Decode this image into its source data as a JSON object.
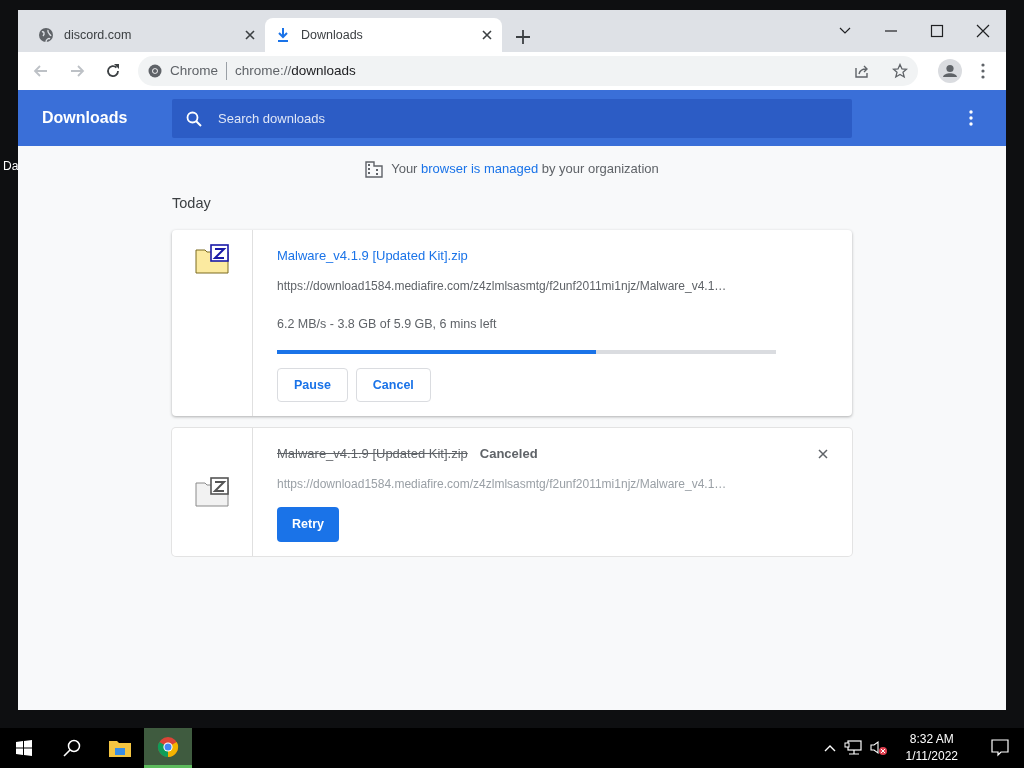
{
  "desktop": {
    "icon_label": "Da"
  },
  "tabs": [
    {
      "title": "discord.com",
      "kind": "site",
      "selected": false
    },
    {
      "title": "Downloads",
      "kind": "download",
      "selected": true
    }
  ],
  "omnibox": {
    "chip": "Chrome",
    "url_prefix": "chrome://",
    "url_path": "downloads"
  },
  "page": {
    "title": "Downloads",
    "search": {
      "placeholder": "Search downloads"
    },
    "managed_notice": {
      "before": "Your",
      "link": "browser is managed",
      "after": "by your organization"
    },
    "section": "Today",
    "downloads": [
      {
        "file_name": "Malware_v4.1.9 [Updated Kit].zip",
        "canceled": false,
        "url": "https://download1584.mediafire.com/z4zlmlsasmtg/f2unf2011mi1njz/Malware_v4.1…",
        "status_text": "6.2 MB/s - 3.8 GB of 5.9 GB, 6 mins left",
        "level": 0.64,
        "buttons": [
          {
            "label": "Pause",
            "kind": "outline"
          },
          {
            "label": "Cancel",
            "kind": "outline"
          }
        ]
      },
      {
        "file_name": "Malware_v4.1.9 [Updated Kit].zip",
        "canceled": true,
        "status_label": "Canceled",
        "url": "https://download1584.mediafire.com/z4zlmlsasmtg/f2unf2011mi1njz/Malware_v4.1…",
        "buttons": [
          {
            "label": "Retry",
            "kind": "primary"
          }
        ]
      }
    ]
  },
  "taskbar": {
    "apps": [
      {
        "kind": "folder",
        "selected": false
      },
      {
        "kind": "chrome",
        "selected": true
      }
    ],
    "time": "8:32 AM",
    "date": "1/11/2022"
  }
}
